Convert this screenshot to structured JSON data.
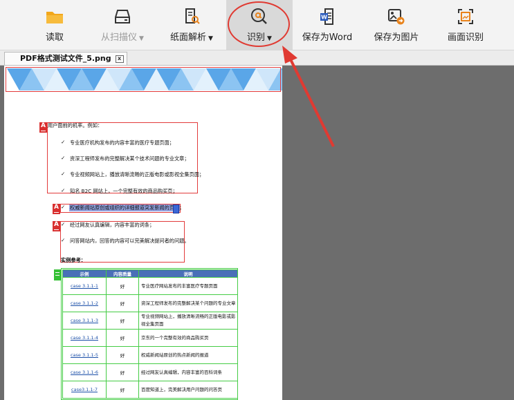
{
  "toolbar": {
    "items": [
      {
        "label": "读取",
        "icon": "folder-icon",
        "disabled": false
      },
      {
        "label": "从扫描仪",
        "icon": "scanner-icon",
        "disabled": true,
        "dropdown": true
      },
      {
        "label": "纸面解析",
        "icon": "document-analyze-icon",
        "disabled": false,
        "dropdown": true
      },
      {
        "label": "识别",
        "icon": "recognize-icon",
        "disabled": false,
        "dropdown": true,
        "active": true
      },
      {
        "label": "保存为Word",
        "icon": "word-icon",
        "disabled": false
      },
      {
        "label": "保存为图片",
        "icon": "image-save-icon",
        "disabled": false
      },
      {
        "label": "画面识别",
        "icon": "screen-recognize-icon",
        "disabled": false
      }
    ],
    "caret": "▼"
  },
  "tab": {
    "title": "PDF格式测试文件_5.png",
    "close": "x"
  },
  "document": {
    "intro": "用户面前的机率。例如：",
    "bullets": [
      "专业医疗机构发布的内容丰富的医疗专题页面；",
      "资深工程师发布的完整解决某个技术问题的专业文章；",
      "专业视频网站上，播放清晰流畅的正版电影或影视全集页面；",
      "知名 B2C 网站上，一个完整有效的商品购买页；",
      "权威新闻站原创或组织的详细报道突发新闻的页面；",
      "经过网友认真编辑，内容丰富的词条；",
      "问答网站内，回答的内容可以完美解决提问者的问题。"
    ],
    "check": "✓",
    "marker": "A",
    "ref_title": "实例参考：",
    "table": {
      "headers": [
        "示例",
        "内容质量",
        "说明"
      ],
      "rows": [
        {
          "case": "case 3.1.1-1",
          "quality": "好",
          "desc": "专业医疗网站发布的丰富医疗专题页面"
        },
        {
          "case": "case 3.1.1-2",
          "quality": "好",
          "desc": "资深工程师发布的完整解决某个问题的专业文章"
        },
        {
          "case": "case 3.1.1-3",
          "quality": "好",
          "desc": "专业视频网站上，播放清晰流畅的正版电影或影视全集页面"
        },
        {
          "case": "case 3.1.1-4",
          "quality": "好",
          "desc": "京东的一个完整有效的商品购买页"
        },
        {
          "case": "case 3.1.1-5",
          "quality": "好",
          "desc": "权威新闻站原创的热点新闻的报道"
        },
        {
          "case": "case 3.1.1-6",
          "quality": "好",
          "desc": "经过网友认真编辑，内容丰富的百科词条"
        },
        {
          "case": "case3.1.1-7",
          "quality": "好",
          "desc": "百度知道上，完美解决用户问题的问答页"
        }
      ]
    }
  },
  "colors": {
    "annotation_red": "#e23a3a",
    "table_green": "#44cc44",
    "header_blue": "#4a6fb8",
    "banner_blue": "#5aa6e8"
  }
}
